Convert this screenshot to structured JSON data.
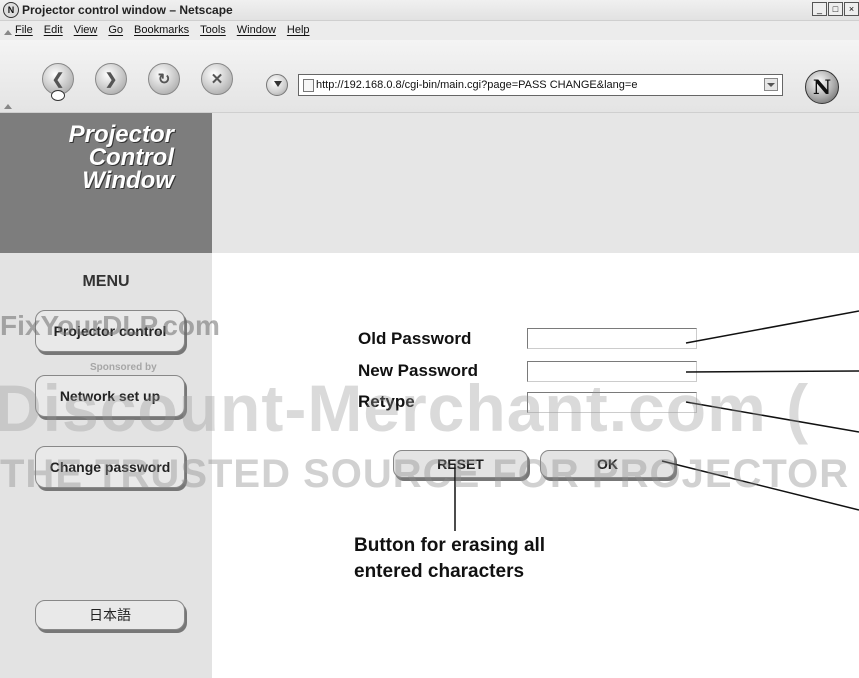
{
  "window": {
    "title": "Projector control window – Netscape",
    "app_icon": "netscape-icon",
    "controls": {
      "minimize": "_",
      "maximize": "□",
      "close": "×"
    }
  },
  "menubar": {
    "items": [
      "File",
      "Edit",
      "View",
      "Go",
      "Bookmarks",
      "Tools",
      "Window",
      "Help"
    ]
  },
  "toolbar": {
    "back_icon": "back-arrow-icon",
    "forward_icon": "forward-arrow-icon",
    "reload_icon": "reload-icon",
    "stop_icon": "stop-icon",
    "url": "http://192.168.0.8/cgi-bin/main.cgi?page=PASS CHANGE&lang=e",
    "logo": "N"
  },
  "page": {
    "logo_lines": [
      "Projector",
      "Control",
      "Window"
    ],
    "menu_title": "MENU",
    "menu_buttons": [
      "Projector control",
      "Network set up",
      "Change password"
    ],
    "language_button": "日本語",
    "form": {
      "old_password_label": "Old Password",
      "new_password_label": "New Password",
      "retype_label": "Retype",
      "old_password_value": "",
      "new_password_value": "",
      "retype_value": ""
    },
    "reset_button": "RESET",
    "ok_button": "OK",
    "callout_line1": "Button for erasing all",
    "callout_line2": "entered characters"
  },
  "watermark": {
    "line1": "FixYourDLP.com",
    "sponsor": "Sponsored by",
    "line2": "Discount-Merchant.com (",
    "line3": "THE TRUSTED SOURCE FOR PROJECTOR LAMP"
  }
}
